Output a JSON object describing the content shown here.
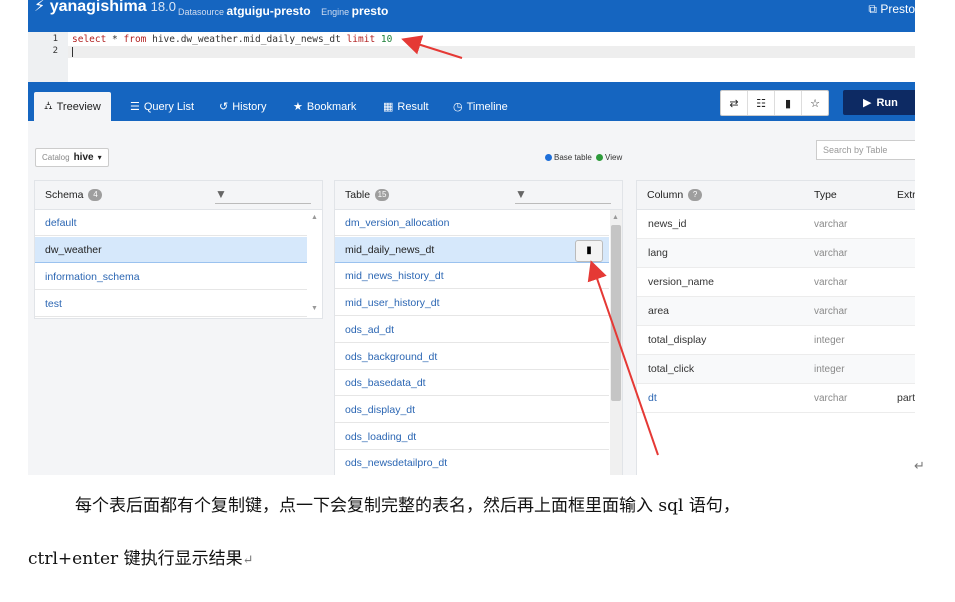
{
  "header": {
    "app_title": "yanagishima",
    "version": "18.0",
    "datasource_label": "Datasource",
    "datasource_value": "atguigu-presto",
    "engine_label": "Engine",
    "engine_value": "presto",
    "right_text": "Presto"
  },
  "editor": {
    "line_numbers": [
      "1",
      "2"
    ],
    "kw_select": "select",
    "tx_star": " * ",
    "kw_from": "from",
    "tx_table": " hive.dw_weather.mid_daily_news_dt ",
    "kw_limit": "limit",
    "num_limit": "10"
  },
  "tabs": {
    "treeview": "Treeview",
    "query_list": "Query List",
    "history": "History",
    "bookmark": "Bookmark",
    "result": "Result",
    "timeline": "Timeline"
  },
  "toolbar": {
    "icons": [
      "swap-icon",
      "format-icon",
      "clipboard-icon",
      "star-outline-icon"
    ],
    "run_label": "Run"
  },
  "catalog": {
    "label": "Catalog",
    "value": "hive"
  },
  "legend": {
    "base_table": "Base table",
    "view": "View",
    "base_color": "#1e6fd9",
    "view_color": "#2e9b3b"
  },
  "search": {
    "placeholder": "Search by Table"
  },
  "schema": {
    "header": "Schema",
    "count": "4",
    "items": [
      "default",
      "dw_weather",
      "information_schema",
      "test"
    ],
    "selected": "dw_weather"
  },
  "table": {
    "header": "Table",
    "count": "15",
    "items": [
      "dm_version_allocation",
      "mid_daily_news_dt",
      "mid_news_history_dt",
      "mid_user_history_dt",
      "ods_ad_dt",
      "ods_background_dt",
      "ods_basedata_dt",
      "ods_display_dt",
      "ods_loading_dt",
      "ods_newsdetailpro_dt"
    ],
    "selected": "mid_daily_news_dt"
  },
  "columns": {
    "header_column": "Column",
    "header_type": "Type",
    "header_extra": "Extra",
    "rows": [
      {
        "name": "news_id",
        "type": "varchar",
        "extra": ""
      },
      {
        "name": "lang",
        "type": "varchar",
        "extra": ""
      },
      {
        "name": "version_name",
        "type": "varchar",
        "extra": ""
      },
      {
        "name": "area",
        "type": "varchar",
        "extra": ""
      },
      {
        "name": "total_display",
        "type": "integer",
        "extra": ""
      },
      {
        "name": "total_click",
        "type": "integer",
        "extra": ""
      },
      {
        "name": "dt",
        "type": "varchar",
        "extra": "part"
      }
    ]
  },
  "caption": {
    "line1": "每个表后面都有个复制键，点一下会复制完整的表名，然后再上面框里面输入 sql 语句，",
    "line2": "ctrl+enter 键执行显示结果"
  },
  "annotation_color": "#e53935"
}
